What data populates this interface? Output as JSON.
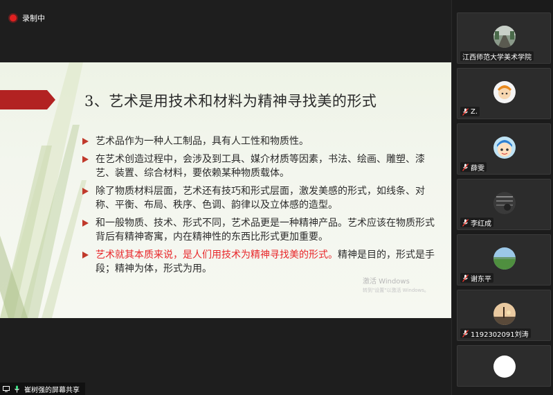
{
  "recording": {
    "label": "录制中"
  },
  "slide": {
    "title": "3、艺术是用技术和材料为精神寻找美的形式",
    "bullets": [
      {
        "text": "艺术品作为一种人工制品，具有人工性和物质性。"
      },
      {
        "text": "在艺术创造过程中，会涉及到工具、媒介材质等因素，书法、绘画、雕塑、漆艺、装置、综合材料，要依赖某种物质载体。"
      },
      {
        "text": "除了物质材料层面，艺术还有技巧和形式层面，激发美感的形式，如线条、对称、平衡、布局、秩序、色调、韵律以及立体感的造型。"
      },
      {
        "text": "和一般物质、技术、形式不同，艺术品更是一种精神产品。艺术应该在物质形式背后有精神寄寓，内在精神性的东西比形式更加重要。"
      },
      {
        "red": "艺术就其本质来说，是人们用技术为精神寻找美的形式。",
        "text": "精神是目的，形式是手段；精神为体，形式为用。"
      }
    ],
    "watermark": {
      "line1": "激活 Windows",
      "line2": "转到\"设置\"以激活 Windows。"
    }
  },
  "share": {
    "label": "崔树强的屏幕共享"
  },
  "participants": [
    {
      "name": "江西师范大学美术学院",
      "muted": false,
      "avatar": "road-photo"
    },
    {
      "name": "Z.",
      "muted": true,
      "avatar": "cartoon-orange"
    },
    {
      "name": "薛雯",
      "muted": true,
      "avatar": "cartoon-kid"
    },
    {
      "name": "李红成",
      "muted": true,
      "avatar": "dark-photo"
    },
    {
      "name": "谢东平",
      "muted": true,
      "avatar": "landscape-photo"
    },
    {
      "name": "1192302091刘涛",
      "muted": true,
      "avatar": "sunset-photo"
    },
    {
      "name": "",
      "muted": false,
      "avatar": "white-circle"
    }
  ],
  "colors": {
    "accent_red": "#e8262a",
    "bullet_red": "#c0392b",
    "banner_red": "#b22222"
  }
}
